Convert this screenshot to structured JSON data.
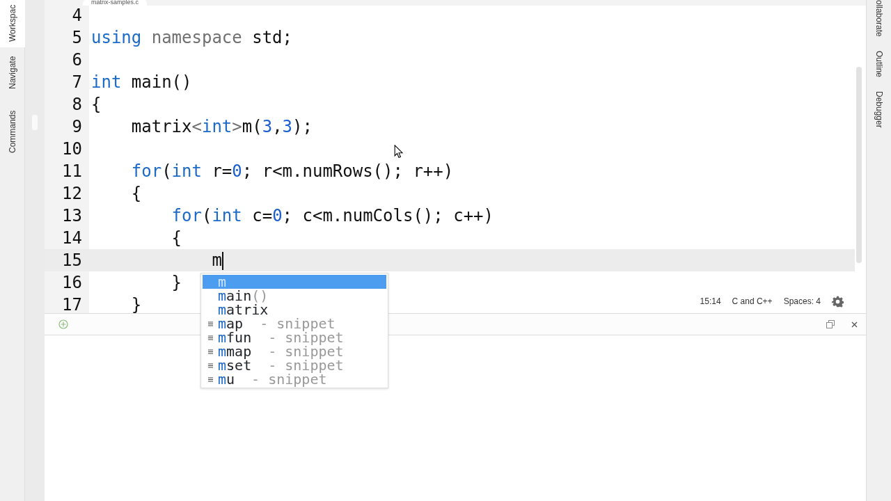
{
  "file_tab": {
    "label": "matrix-samples.c"
  },
  "left_tabs": [
    {
      "label": "Workspac",
      "selected": true
    },
    {
      "label": "Navigate",
      "selected": false
    },
    {
      "label": "Commands",
      "selected": false
    }
  ],
  "right_tabs": [
    {
      "label": "ollaborate"
    },
    {
      "label": "Outline"
    },
    {
      "label": "Debugger"
    }
  ],
  "editor": {
    "lines": [
      {
        "number": "4",
        "current": false
      },
      {
        "number": "5",
        "current": false,
        "tokens": [
          {
            "text": "using",
            "kind": "keyword"
          },
          {
            "text": " namespace",
            "kind": "muted"
          },
          {
            "text": " std;",
            "kind": "plain"
          }
        ]
      },
      {
        "number": "6",
        "current": false
      },
      {
        "number": "7",
        "current": false,
        "tokens": [
          {
            "text": "int",
            "kind": "keyword"
          },
          {
            "text": " main()",
            "kind": "plain"
          }
        ]
      },
      {
        "number": "8",
        "current": false,
        "tokens": [
          {
            "text": "{",
            "kind": "plain"
          }
        ]
      },
      {
        "number": "9",
        "current": false,
        "tokens": [
          {
            "text": "    matrix",
            "kind": "plain"
          },
          {
            "text": "<",
            "kind": "muted"
          },
          {
            "text": "int",
            "kind": "keyword"
          },
          {
            "text": ">",
            "kind": "muted"
          },
          {
            "text": "m(",
            "kind": "plain"
          },
          {
            "text": "3",
            "kind": "number"
          },
          {
            "text": ",",
            "kind": "plain"
          },
          {
            "text": "3",
            "kind": "number"
          },
          {
            "text": ");",
            "kind": "plain"
          }
        ]
      },
      {
        "number": "10",
        "current": false
      },
      {
        "number": "11",
        "current": false,
        "tokens": [
          {
            "text": "    for",
            "kind": "keyword"
          },
          {
            "text": "(",
            "kind": "plain"
          },
          {
            "text": "int",
            "kind": "keyword"
          },
          {
            "text": " r=",
            "kind": "plain"
          },
          {
            "text": "0",
            "kind": "number"
          },
          {
            "text": "; r<m.numRows(); r++)",
            "kind": "plain"
          }
        ]
      },
      {
        "number": "12",
        "current": false,
        "tokens": [
          {
            "text": "    {",
            "kind": "plain"
          }
        ]
      },
      {
        "number": "13",
        "current": false,
        "tokens": [
          {
            "text": "        for",
            "kind": "keyword"
          },
          {
            "text": "(",
            "kind": "plain"
          },
          {
            "text": "int",
            "kind": "keyword"
          },
          {
            "text": " c=",
            "kind": "plain"
          },
          {
            "text": "0",
            "kind": "number"
          },
          {
            "text": "; c<m.numCols(); c++)",
            "kind": "plain"
          }
        ]
      },
      {
        "number": "14",
        "current": false,
        "tokens": [
          {
            "text": "        {",
            "kind": "plain"
          }
        ]
      },
      {
        "number": "15",
        "current": true,
        "tokens": [
          {
            "text": "            m",
            "kind": "plain"
          }
        ]
      },
      {
        "number": "16",
        "current": false,
        "tokens": [
          {
            "text": "        }",
            "kind": "plain"
          }
        ]
      },
      {
        "number": "17",
        "current": false,
        "tokens": [
          {
            "text": "    }",
            "kind": "plain"
          }
        ]
      }
    ]
  },
  "autocomplete": [
    {
      "match": "m",
      "kind": "word",
      "selected": true
    },
    {
      "match": "m",
      "rest": "ain",
      "detail": "()",
      "kind": "word",
      "selected": false
    },
    {
      "match": "m",
      "rest": "atrix",
      "kind": "word",
      "selected": false
    },
    {
      "match": "m",
      "rest": "ap",
      "detail": "- snippet",
      "kind": "snippet",
      "selected": false
    },
    {
      "match": "m",
      "rest": "fun",
      "detail": "- snippet",
      "kind": "snippet",
      "selected": false
    },
    {
      "match": "m",
      "rest": "map",
      "detail": "- snippet",
      "kind": "snippet",
      "selected": false
    },
    {
      "match": "m",
      "rest": "set",
      "detail": "- snippet",
      "kind": "snippet",
      "selected": false
    },
    {
      "match": "m",
      "rest": "u",
      "detail": "- snippet",
      "kind": "snippet",
      "selected": false
    }
  ],
  "status_bar": {
    "position": "15:14",
    "language": "C and C++",
    "indentation": "Spaces: 4"
  }
}
